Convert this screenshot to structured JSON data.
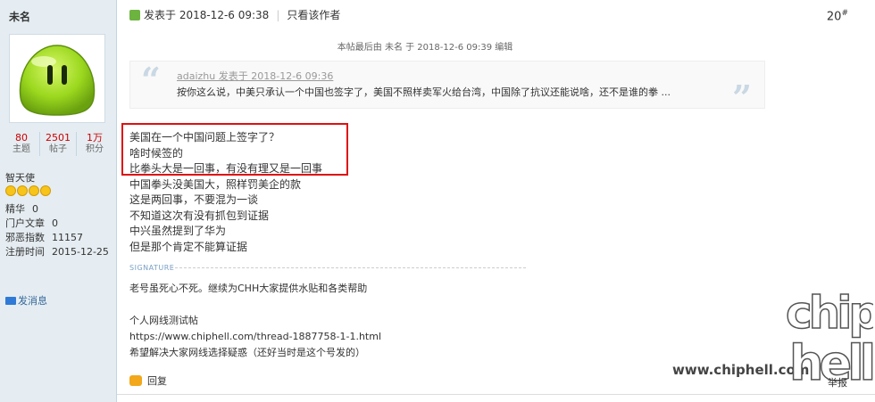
{
  "user": {
    "name": "未名",
    "stats": [
      {
        "num": "80",
        "label": "主题"
      },
      {
        "num": "2501",
        "label": "帖子"
      },
      {
        "num": "1万",
        "label": "积分"
      }
    ],
    "rank": "智天使",
    "info": [
      {
        "k": "精华",
        "v": "0"
      },
      {
        "k": "门户文章",
        "v": "0"
      },
      {
        "k": "邪恶指数",
        "v": "11157"
      },
      {
        "k": "注册时间",
        "v": "2015-12-25"
      }
    ],
    "message_label": "发消息"
  },
  "post": {
    "posted": "发表于 2018-12-6 09:38",
    "only_author": "只看该作者",
    "floor": "20",
    "floor_sup": "#",
    "edit_note": "本帖最后由 未名 于 2018-12-6 09:39 编辑",
    "quote": {
      "author_line": "adaizhu 发表于 2018-12-6 09:36",
      "text": "按你这么说，中美只承认一个中国也签字了，美国不照样卖军火给台湾，中国除了抗议还能说啥，还不是谁的拳 ..."
    },
    "lines": [
      "美国在一个中国问题上签字了？",
      "啥时候签的",
      "比拳头大是一回事，有没有理又是一回事",
      "中国拳头没美国大，照样罚美企的款",
      "这是两回事，不要混为一谈",
      "不知道这次有没有抓包到证据",
      "中兴虽然提到了华为",
      "但是那个肯定不能算证据"
    ],
    "signature_label": "SIGNATURE",
    "signature": [
      "老号虽死心不死。继续为CHH大家提供水贴和各类帮助",
      "",
      "个人网线测试帖",
      "https://www.chiphell.com/thread-1887758-1-1.html",
      "希望解决大家网线选择疑惑（还好当时是这个号发的）"
    ],
    "reply_label": "回复",
    "report_label": "举报"
  },
  "watermark": {
    "site": "www.chiphell.com",
    "logo_top": "chip",
    "logo_bottom": "hell"
  }
}
